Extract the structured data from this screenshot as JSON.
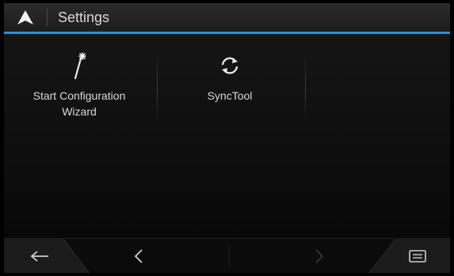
{
  "header": {
    "title": "Settings",
    "nav_icon": "navigation-arrow-icon"
  },
  "tiles": [
    {
      "label": "Start Configuration\nWizard",
      "icon": "magic-wand-icon"
    },
    {
      "label": "SyncTool",
      "icon": "sync-icon"
    }
  ],
  "footer": {
    "back_icon": "back-arrow-icon",
    "prev_icon": "chevron-left-icon",
    "next_icon": "chevron-right-icon",
    "menu_icon": "menu-icon"
  },
  "colors": {
    "accent": "#2a8fd6",
    "text": "#d8d8d8",
    "background": "#0a0a0a"
  }
}
